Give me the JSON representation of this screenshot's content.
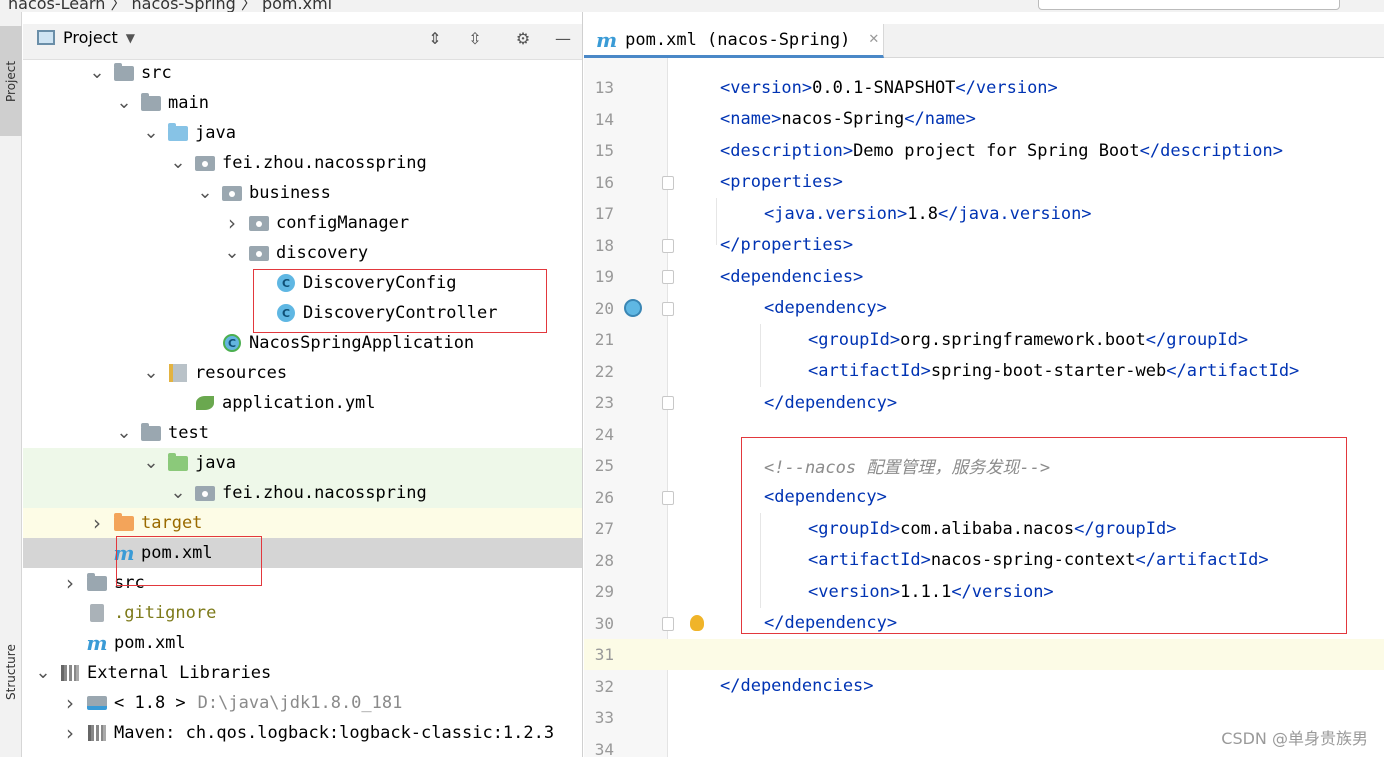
{
  "top_bar": {
    "breadcrumb": "nacos-Learn  〉 nacos-Spring  〉 pom.xml"
  },
  "tool_window_tabs": {
    "project": "Project",
    "structure": "Structure"
  },
  "project_panel": {
    "title": "Project",
    "tree": [
      {
        "label": "src",
        "icon": "folder-icon",
        "expanded": true
      },
      {
        "label": "main",
        "icon": "folder-icon",
        "expanded": true
      },
      {
        "label": "java",
        "icon": "source-folder-icon",
        "expanded": true
      },
      {
        "label": "fei.zhou.nacosspring",
        "icon": "package-icon",
        "expanded": true
      },
      {
        "label": "business",
        "icon": "package-icon",
        "expanded": true
      },
      {
        "label": "configManager",
        "icon": "package-icon",
        "expanded": false
      },
      {
        "label": "discovery",
        "icon": "package-icon",
        "expanded": true
      },
      {
        "label": "DiscoveryConfig",
        "icon": "class-icon"
      },
      {
        "label": "DiscoveryController",
        "icon": "class-icon"
      },
      {
        "label": "NacosSpringApplication",
        "icon": "spring-boot-class-icon"
      },
      {
        "label": "resources",
        "icon": "resources-folder-icon",
        "expanded": true
      },
      {
        "label": "application.yml",
        "icon": "spring-yml-icon"
      },
      {
        "label": "test",
        "icon": "folder-icon",
        "expanded": true
      },
      {
        "label": "java",
        "icon": "test-folder-icon",
        "expanded": true
      },
      {
        "label": "fei.zhou.nacosspring",
        "icon": "package-icon",
        "expanded": true
      },
      {
        "label": "target",
        "icon": "excluded-folder-icon",
        "expanded": false
      },
      {
        "label": "pom.xml",
        "icon": "maven-icon",
        "selected": true
      },
      {
        "label": "src",
        "icon": "folder-icon",
        "expanded": false
      },
      {
        "label": ".gitignore",
        "icon": "gitignore-icon"
      },
      {
        "label": "pom.xml",
        "icon": "maven-icon"
      },
      {
        "label": "External Libraries",
        "icon": "libraries-icon",
        "expanded": true
      },
      {
        "label": "< 1.8 >",
        "detail": "D:\\java\\jdk1.8.0_181",
        "icon": "jdk-icon",
        "expanded": false
      },
      {
        "label": "Maven: ch.qos.logback:logback-classic:1.2.3",
        "icon": "library-icon",
        "expanded": false
      }
    ]
  },
  "editor": {
    "tab_label": "pom.xml (nacos-Spring)",
    "lines": [
      {
        "n": "13",
        "indent": 1,
        "parts": [
          [
            "tag",
            "<version>"
          ],
          [
            "text",
            "0.0.1-SNAPSHOT"
          ],
          [
            "tag",
            "</version>"
          ]
        ]
      },
      {
        "n": "14",
        "indent": 1,
        "parts": [
          [
            "tag",
            "<name>"
          ],
          [
            "text",
            "nacos-Spring"
          ],
          [
            "tag",
            "</name>"
          ]
        ]
      },
      {
        "n": "15",
        "indent": 1,
        "parts": [
          [
            "tag",
            "<description>"
          ],
          [
            "text",
            "Demo project for Spring Boot"
          ],
          [
            "tag",
            "</description>"
          ]
        ]
      },
      {
        "n": "16",
        "indent": 1,
        "parts": [
          [
            "tag",
            "<properties>"
          ]
        ]
      },
      {
        "n": "17",
        "indent": 2,
        "parts": [
          [
            "tag",
            "<java.version>"
          ],
          [
            "text",
            "1.8"
          ],
          [
            "tag",
            "</java.version>"
          ]
        ]
      },
      {
        "n": "18",
        "indent": 1,
        "parts": [
          [
            "tag",
            "</properties>"
          ]
        ]
      },
      {
        "n": "19",
        "indent": 1,
        "parts": [
          [
            "tag",
            "<dependencies>"
          ]
        ]
      },
      {
        "n": "20",
        "indent": 2,
        "parts": [
          [
            "tag",
            "<dependency>"
          ]
        ]
      },
      {
        "n": "21",
        "indent": 3,
        "parts": [
          [
            "tag",
            "<groupId>"
          ],
          [
            "text",
            "org.springframework.boot"
          ],
          [
            "tag",
            "</groupId>"
          ]
        ]
      },
      {
        "n": "22",
        "indent": 3,
        "parts": [
          [
            "tag",
            "<artifactId>"
          ],
          [
            "text",
            "spring-boot-starter-web"
          ],
          [
            "tag",
            "</artifactId>"
          ]
        ]
      },
      {
        "n": "23",
        "indent": 2,
        "parts": [
          [
            "tag",
            "</dependency>"
          ]
        ]
      },
      {
        "n": "24",
        "indent": 0,
        "parts": []
      },
      {
        "n": "25",
        "indent": 2,
        "parts": [
          [
            "cmt",
            "<!--nacos 配置管理，服务发现-->"
          ]
        ]
      },
      {
        "n": "26",
        "indent": 2,
        "parts": [
          [
            "tag",
            "<dependency>"
          ]
        ]
      },
      {
        "n": "27",
        "indent": 3,
        "parts": [
          [
            "tag",
            "<groupId>"
          ],
          [
            "text",
            "com.alibaba.nacos"
          ],
          [
            "tag",
            "</groupId>"
          ]
        ]
      },
      {
        "n": "28",
        "indent": 3,
        "parts": [
          [
            "tag",
            "<artifactId>"
          ],
          [
            "text",
            "nacos-spring-context"
          ],
          [
            "tag",
            "</artifactId>"
          ]
        ]
      },
      {
        "n": "29",
        "indent": 3,
        "parts": [
          [
            "tag",
            "<version>"
          ],
          [
            "text",
            "1.1.1"
          ],
          [
            "tag",
            "</version>"
          ]
        ]
      },
      {
        "n": "30",
        "indent": 2,
        "parts": [
          [
            "tag",
            "</dependency>"
          ]
        ]
      },
      {
        "n": "31",
        "indent": 0,
        "parts": [],
        "current": true
      },
      {
        "n": "32",
        "indent": 1,
        "parts": [
          [
            "tag",
            "</dependencies>"
          ]
        ]
      },
      {
        "n": "33",
        "indent": 0,
        "parts": []
      },
      {
        "n": "34",
        "indent": 0,
        "parts": []
      }
    ]
  },
  "watermark": "CSDN @单身贵族男"
}
